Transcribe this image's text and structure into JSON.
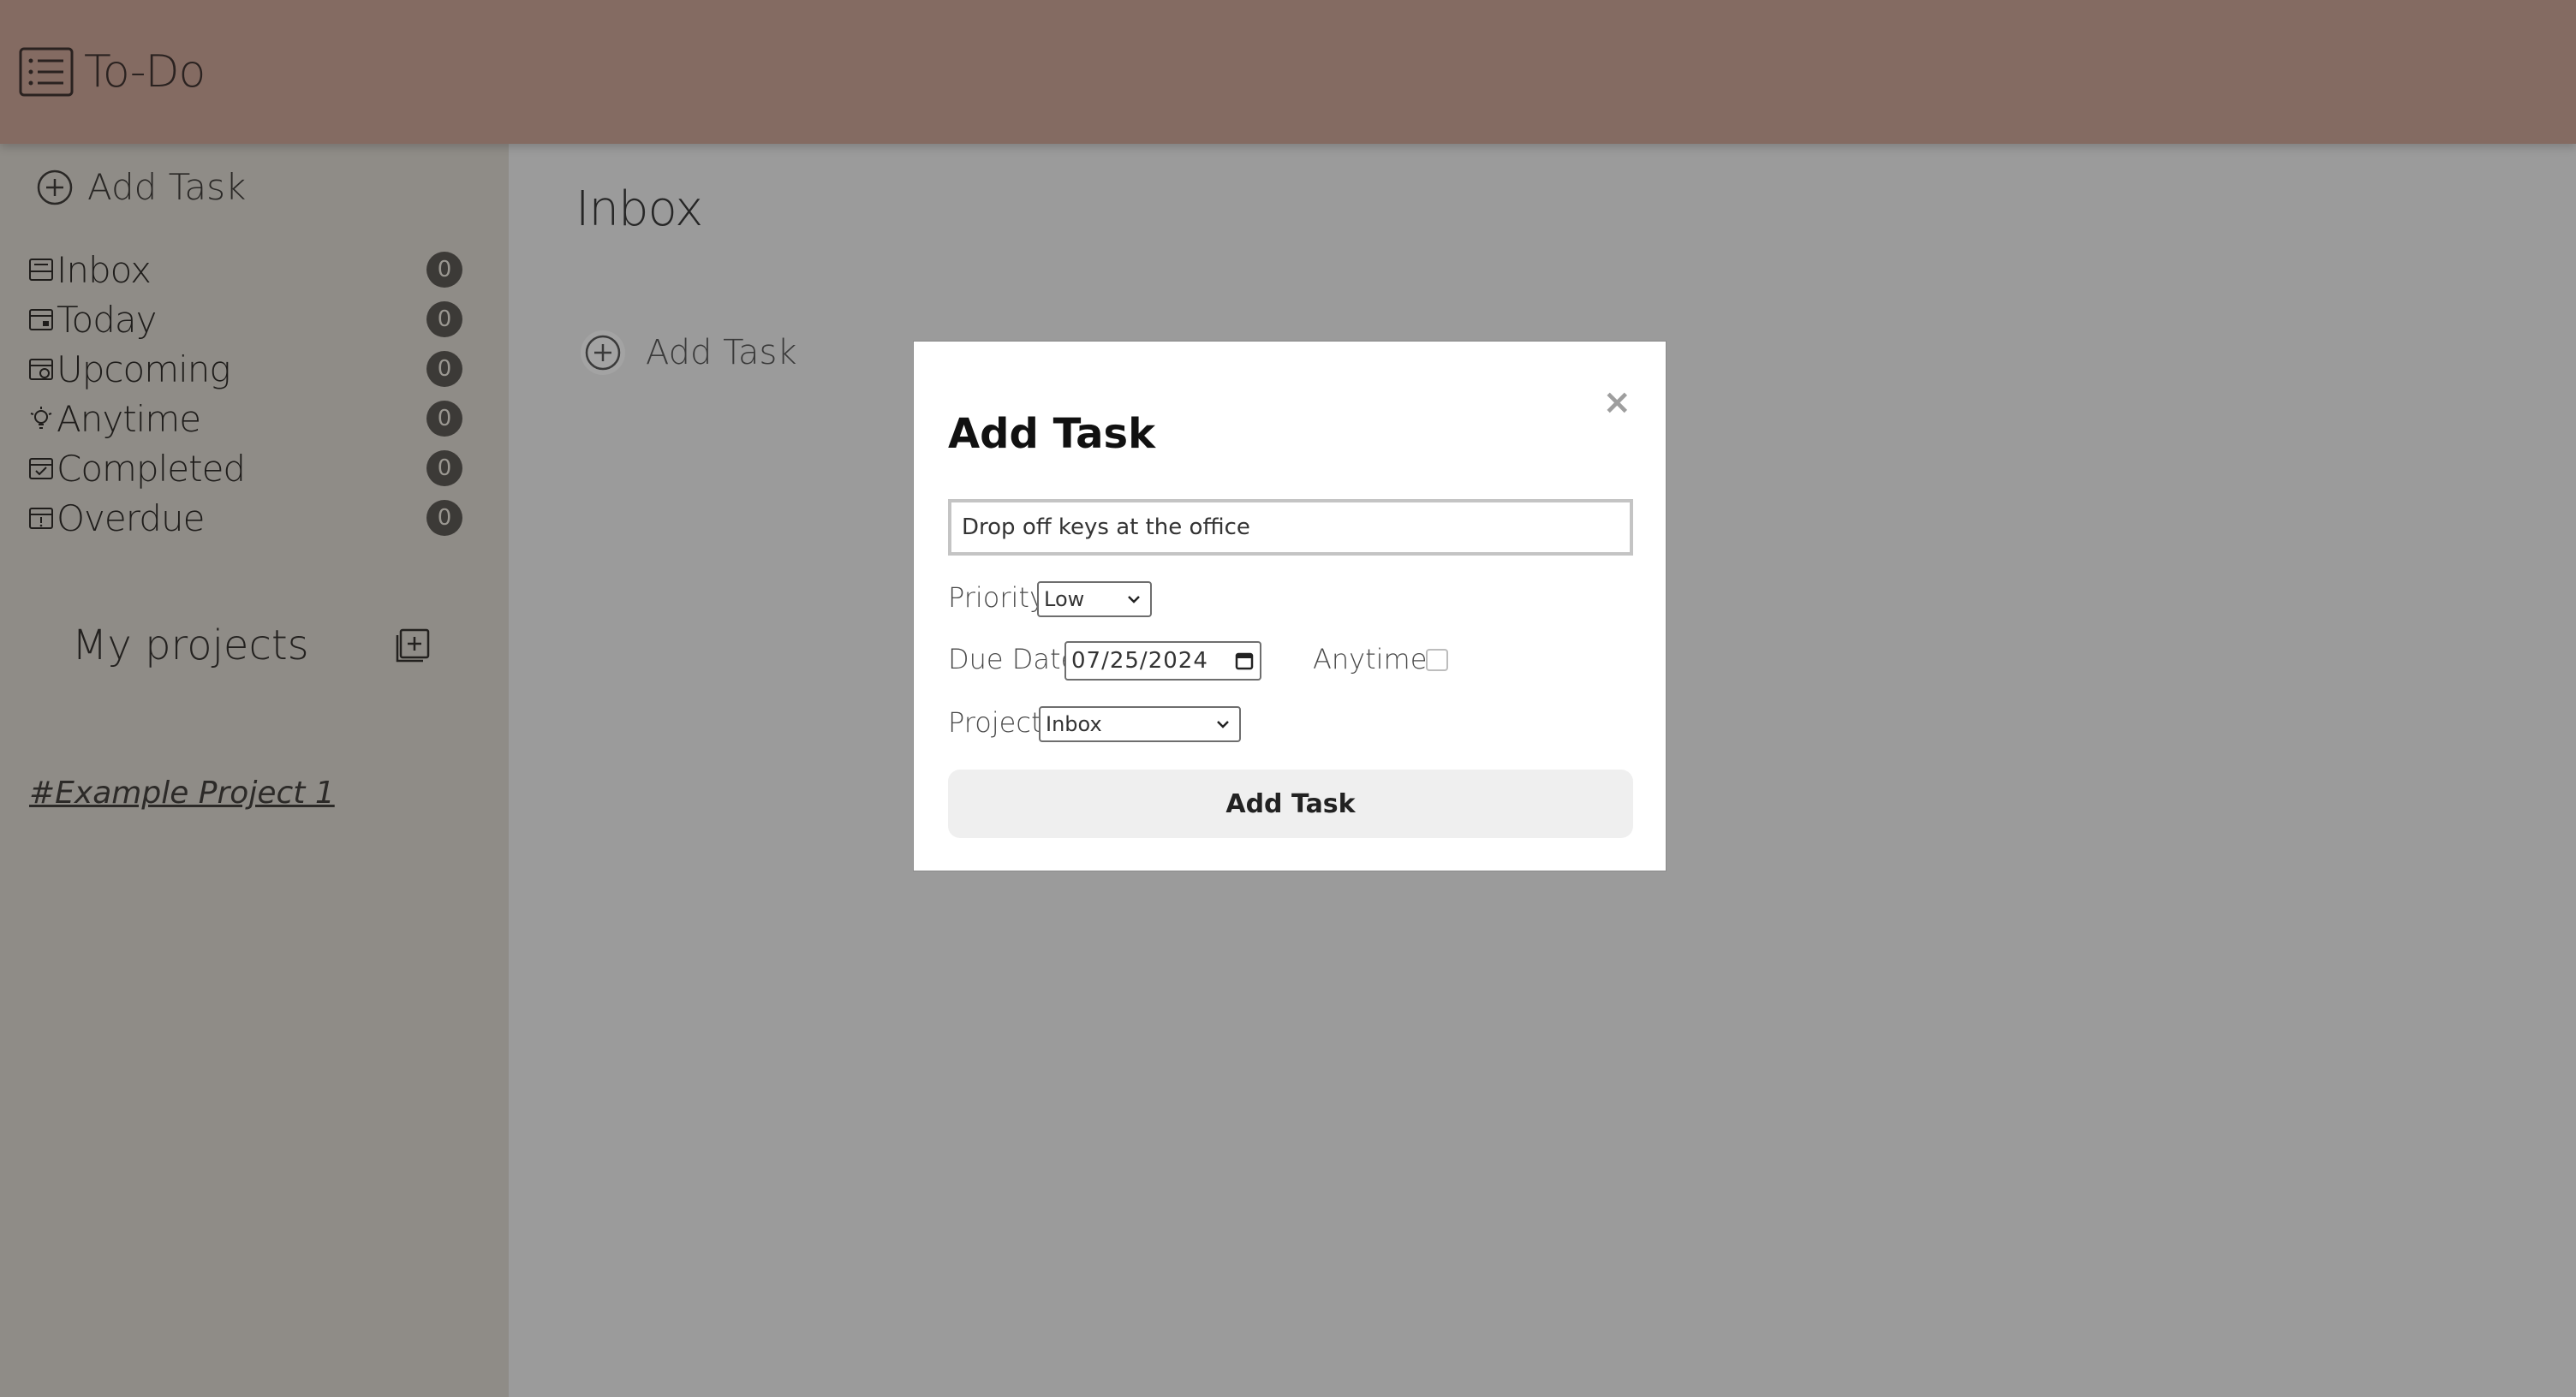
{
  "header": {
    "title": "To-Do",
    "icon": "list-icon"
  },
  "sidebar": {
    "add_task_label": "Add Task",
    "items": [
      {
        "label": "Inbox",
        "count": "0",
        "icon": "inbox-icon"
      },
      {
        "label": "Today",
        "count": "0",
        "icon": "calendar-today-icon"
      },
      {
        "label": "Upcoming",
        "count": "0",
        "icon": "calendar-clock-icon"
      },
      {
        "label": "Anytime",
        "count": "0",
        "icon": "lightbulb-icon"
      },
      {
        "label": "Completed",
        "count": "0",
        "icon": "calendar-check-icon"
      },
      {
        "label": "Overdue",
        "count": "0",
        "icon": "calendar-alert-icon"
      }
    ],
    "projects_title": "My projects",
    "projects": [
      {
        "label": "#Example Project 1"
      }
    ]
  },
  "main": {
    "title": "Inbox",
    "add_task_label": "Add Task"
  },
  "modal": {
    "title": "Add Task",
    "close_glyph": "×",
    "task_value": "Drop off keys at the office",
    "priority_label": "Priority",
    "priority_value": "Low",
    "due_date_label": "Due Date",
    "due_date_value": "07/25/2024",
    "anytime_label": "Anytime",
    "anytime_checked": false,
    "project_label": "Project",
    "project_value": "Inbox",
    "submit_label": "Add Task"
  },
  "colors": {
    "header_bg": "#846b62",
    "sidebar_bg": "#8f8c87",
    "main_bg": "#9b9b9b",
    "badge_bg": "#3c3a37",
    "modal_bg": "#ffffff",
    "submit_bg": "#efefef"
  }
}
